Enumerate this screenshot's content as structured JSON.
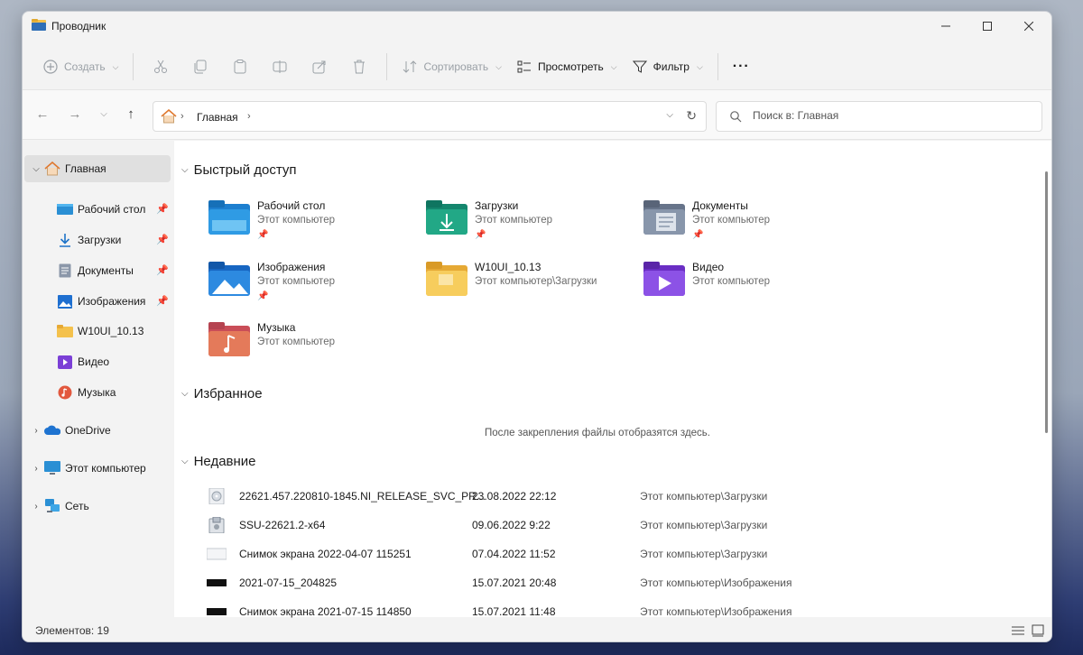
{
  "window": {
    "title": "Проводник"
  },
  "toolbar": {
    "new_label": "Создать",
    "sort_label": "Сортировать",
    "view_label": "Просмотреть",
    "filter_label": "Фильтр",
    "more_label": "···"
  },
  "address": {
    "path": "Главная"
  },
  "search": {
    "placeholder": "Поиск в: Главная"
  },
  "sidebar": {
    "items": [
      {
        "label": "Главная",
        "icon": "home-icon"
      },
      {
        "label": "Рабочий стол",
        "icon": "desktop-icon"
      },
      {
        "label": "Загрузки",
        "icon": "download-icon"
      },
      {
        "label": "Документы",
        "icon": "documents-icon"
      },
      {
        "label": "Изображения",
        "icon": "pictures-icon"
      },
      {
        "label": "W10UI_10.13",
        "icon": "folder-icon"
      },
      {
        "label": "Видео",
        "icon": "video-icon"
      },
      {
        "label": "Музыка",
        "icon": "music-icon"
      },
      {
        "label": "OneDrive",
        "icon": "cloud-icon"
      },
      {
        "label": "Этот компьютер",
        "icon": "computer-icon"
      },
      {
        "label": "Сеть",
        "icon": "network-icon"
      }
    ]
  },
  "main": {
    "quick_access": {
      "heading": "Быстрый доступ",
      "tiles": [
        {
          "name": "Рабочий стол",
          "sub": "Этот компьютер",
          "icon": "desktop-folder-icon"
        },
        {
          "name": "Загрузки",
          "sub": "Этот компьютер",
          "icon": "downloads-folder-icon"
        },
        {
          "name": "Документы",
          "sub": "Этот компьютер",
          "icon": "documents-folder-icon"
        },
        {
          "name": "Изображения",
          "sub": "Этот компьютер",
          "icon": "pictures-folder-icon"
        },
        {
          "name": "W10UI_10.13",
          "sub": "Этот компьютер\\Загрузки",
          "icon": "folder-icon"
        },
        {
          "name": "Видео",
          "sub": "Этот компьютер",
          "icon": "video-folder-icon"
        },
        {
          "name": "Музыка",
          "sub": "Этот компьютер",
          "icon": "music-folder-icon"
        }
      ]
    },
    "favorites": {
      "heading": "Избранное",
      "empty_text": "После закрепления файлы отобразятся здесь."
    },
    "recent": {
      "heading": "Недавние",
      "rows": [
        {
          "name": "22621.457.220810-1845.NI_RELEASE_SVC_PR...",
          "date": "23.08.2022 22:12",
          "location": "Этот компьютер\\Загрузки",
          "icon": "disc-image-icon"
        },
        {
          "name": "SSU-22621.2-x64",
          "date": "09.06.2022 9:22",
          "location": "Этот компьютер\\Загрузки",
          "icon": "package-icon"
        },
        {
          "name": "Снимок экрана 2022-04-07 115251",
          "date": "07.04.2022 11:52",
          "location": "Этот компьютер\\Загрузки",
          "icon": "image-file-icon"
        },
        {
          "name": "2021-07-15_204825",
          "date": "15.07.2021 20:48",
          "location": "Этот компьютер\\Изображения",
          "icon": "image-file-icon"
        },
        {
          "name": "Снимок экрана 2021-07-15 114850",
          "date": "15.07.2021 11:48",
          "location": "Этот компьютер\\Изображения",
          "icon": "image-file-icon"
        }
      ]
    }
  },
  "status": {
    "count": "Элементов: 19"
  },
  "colors": {
    "accent": "#0078d4",
    "folder_yellow": "#f4c14c"
  }
}
